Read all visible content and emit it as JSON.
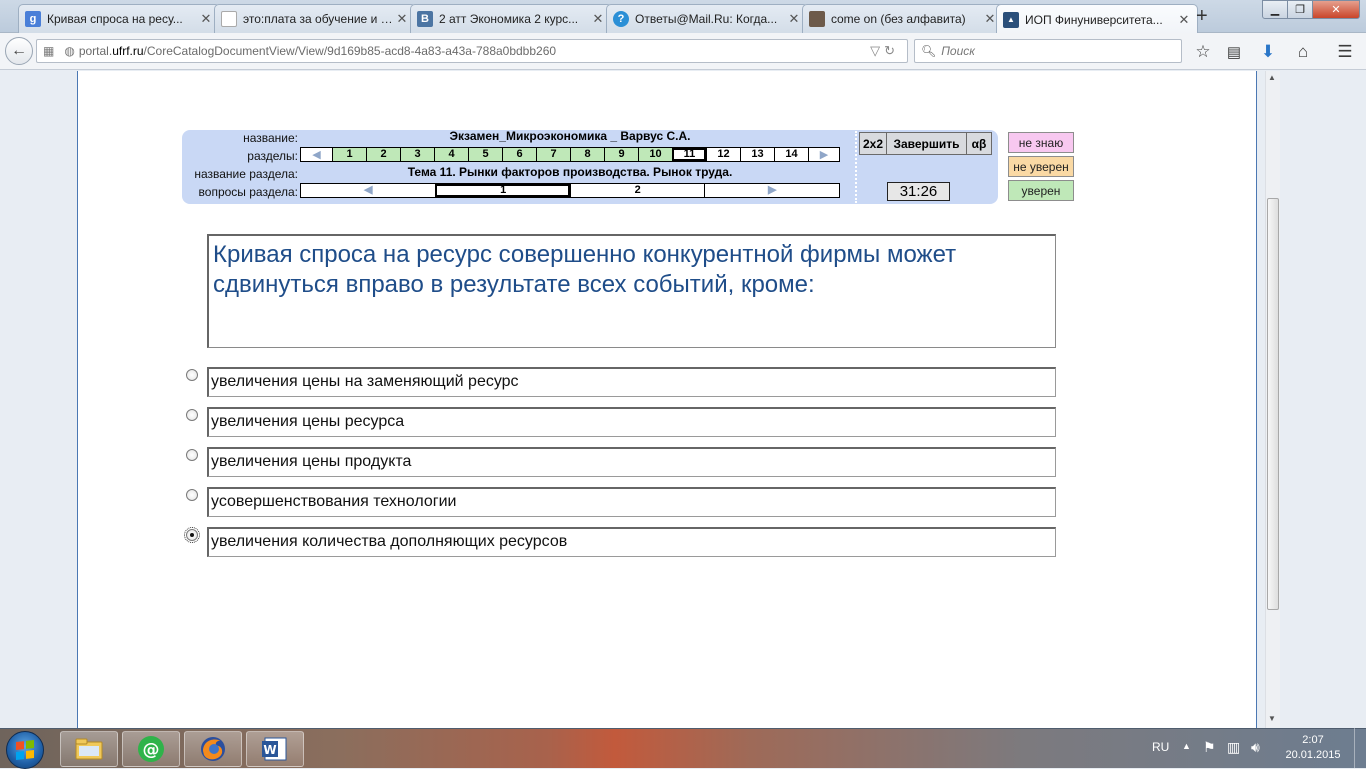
{
  "browser": {
    "tabs": [
      {
        "title": "Кривая спроса на ресу...",
        "icon": "google-icon",
        "icon_letter": "g",
        "icon_color": "#4a7fd8",
        "active": false
      },
      {
        "title": "это:плата за обучение и ут...",
        "icon": "blank-page-icon",
        "icon_letter": "",
        "icon_color": "#ffffff",
        "active": false
      },
      {
        "title": "2 атт Экономика 2 курс...",
        "icon": "vk-icon",
        "icon_letter": "В",
        "icon_color": "#4c75a3",
        "active": false
      },
      {
        "title": "Ответы@Mail.Ru: Когда...",
        "icon": "answers-mail-icon",
        "icon_letter": "?",
        "icon_color": "#2b8fd6",
        "active": false
      },
      {
        "title": "come on (без алфавита)",
        "icon": "photo-favicon-icon",
        "icon_letter": "",
        "icon_color": "#6d5a4a",
        "active": false
      },
      {
        "title": "ИОП Финуниверситета...",
        "icon": "graduation-cap-icon",
        "icon_letter": "▲",
        "icon_color": "#2a4f7a",
        "active": true
      }
    ],
    "url_host": "portal.",
    "url_domain": "ufrf.ru",
    "url_path": "/CoreCatalogDocumentView/View/9d169b85-acd8-4a83-a43a-788a0bdbb260",
    "search_placeholder": "Поиск"
  },
  "exam": {
    "labels": {
      "name": "название:",
      "sections": "разделы:",
      "section_name": "название раздела:",
      "section_questions": "вопросы раздела:"
    },
    "title": "Экзамен_Микроэкономика _ Варвус С.А.",
    "sections": [
      "1",
      "2",
      "3",
      "4",
      "5",
      "6",
      "7",
      "8",
      "9",
      "10",
      "11",
      "12",
      "13",
      "14"
    ],
    "completed_sections": 10,
    "current_section": "11",
    "section_title": "Тема 11. Рынки факторов производства. Рынок труда.",
    "questions": [
      "1",
      "2"
    ],
    "current_question": "1",
    "buttons": {
      "two_by_two": "2x2",
      "finish": "Завершить",
      "alpha_beta": "αβ"
    },
    "timer": "31:26",
    "confidence": [
      {
        "label": "не знаю",
        "color": "#f8c8f0"
      },
      {
        "label": "не уверен",
        "color": "#fad9a4"
      },
      {
        "label": "уверен",
        "color": "#bfe8b8"
      }
    ]
  },
  "question": {
    "text": "Кривая спроса на ресурс совершенно конкурентной фирмы может сдвинуться вправо в результате всех событий, кроме:",
    "answers": [
      {
        "text": "увеличения цены на заменяющий ресурс",
        "selected": false
      },
      {
        "text": "увеличения цены ресурса",
        "selected": false
      },
      {
        "text": "увеличения цены продукта",
        "selected": false
      },
      {
        "text": "усовершенствования технологии",
        "selected": false
      },
      {
        "text": "увеличения количества дополняющих ресурсов",
        "selected": true
      }
    ]
  },
  "taskbar": {
    "language": "RU",
    "time": "2:07",
    "date": "20.01.2015",
    "apps": [
      "file-explorer-icon",
      "mail-agent-icon",
      "firefox-icon",
      "word-icon"
    ]
  }
}
